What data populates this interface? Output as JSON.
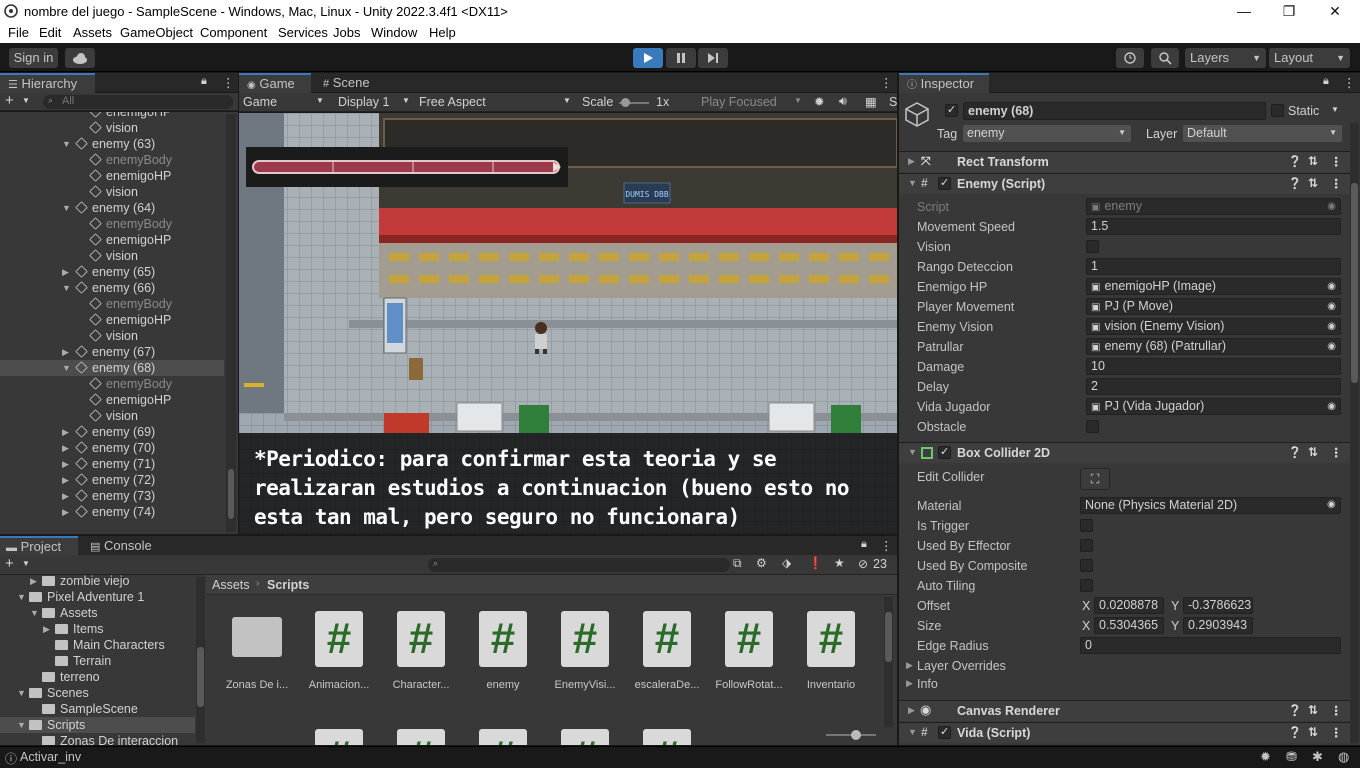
{
  "window": {
    "title": "nombre del juego - SampleScene - Windows, Mac, Linux - Unity 2022.3.4f1 <DX11>"
  },
  "menu": [
    "File",
    "Edit",
    "Assets",
    "GameObject",
    "Component",
    "Services",
    "Jobs",
    "Window",
    "Help"
  ],
  "toolbar": {
    "sign_in": "Sign in",
    "layers": "Layers",
    "layout": "Layout"
  },
  "hierarchy": {
    "tab": "Hierarchy",
    "search_placeholder": "All",
    "rows": [
      {
        "label": "enemigoHP",
        "indent": 2,
        "arrow": ""
      },
      {
        "label": "vision",
        "indent": 2,
        "arrow": ""
      },
      {
        "label": "enemy (63)",
        "indent": 1,
        "arrow": "▼"
      },
      {
        "label": "enemyBody",
        "indent": 2,
        "arrow": "",
        "dim": true
      },
      {
        "label": "enemigoHP",
        "indent": 2,
        "arrow": ""
      },
      {
        "label": "vision",
        "indent": 2,
        "arrow": ""
      },
      {
        "label": "enemy (64)",
        "indent": 1,
        "arrow": "▼"
      },
      {
        "label": "enemyBody",
        "indent": 2,
        "arrow": "",
        "dim": true
      },
      {
        "label": "enemigoHP",
        "indent": 2,
        "arrow": ""
      },
      {
        "label": "vision",
        "indent": 2,
        "arrow": ""
      },
      {
        "label": "enemy (65)",
        "indent": 1,
        "arrow": "▶"
      },
      {
        "label": "enemy (66)",
        "indent": 1,
        "arrow": "▼"
      },
      {
        "label": "enemyBody",
        "indent": 2,
        "arrow": "",
        "dim": true
      },
      {
        "label": "enemigoHP",
        "indent": 2,
        "arrow": ""
      },
      {
        "label": "vision",
        "indent": 2,
        "arrow": ""
      },
      {
        "label": "enemy (67)",
        "indent": 1,
        "arrow": "▶"
      },
      {
        "label": "enemy (68)",
        "indent": 1,
        "arrow": "▼",
        "selected": true
      },
      {
        "label": "enemyBody",
        "indent": 2,
        "arrow": "",
        "dim": true
      },
      {
        "label": "enemigoHP",
        "indent": 2,
        "arrow": ""
      },
      {
        "label": "vision",
        "indent": 2,
        "arrow": ""
      },
      {
        "label": "enemy (69)",
        "indent": 1,
        "arrow": "▶"
      },
      {
        "label": "enemy (70)",
        "indent": 1,
        "arrow": "▶"
      },
      {
        "label": "enemy (71)",
        "indent": 1,
        "arrow": "▶"
      },
      {
        "label": "enemy (72)",
        "indent": 1,
        "arrow": "▶"
      },
      {
        "label": "enemy (73)",
        "indent": 1,
        "arrow": "▶"
      },
      {
        "label": "enemy (74)",
        "indent": 1,
        "arrow": "▶"
      }
    ]
  },
  "game": {
    "tab_game": "Game",
    "tab_scene": "Scene",
    "view": "Game",
    "display": "Display 1",
    "aspect": "Free Aspect",
    "scale_label": "Scale",
    "scale_value": "1x",
    "play_focused": "Play Focused",
    "sign_text": "DUMIS DBB",
    "dialog_line1": "*Periodico: para confirmar esta teoria y se",
    "dialog_line2": "realizaran estudios a continuacion (bueno esto no",
    "dialog_line3": "esta tan mal, pero seguro no funcionara)"
  },
  "inspector": {
    "tab": "Inspector",
    "object_name": "enemy (68)",
    "static": "Static",
    "tag_label": "Tag",
    "tag": "enemy",
    "layer_label": "Layer",
    "layer": "Default",
    "rect_transform": "Rect Transform",
    "enemy_script": "Enemy (Script)",
    "fields": [
      {
        "label": "Script",
        "value": "enemy",
        "type": "obj",
        "dim": true
      },
      {
        "label": "Movement Speed",
        "value": "1.5",
        "type": "text"
      },
      {
        "label": "Vision",
        "value": "",
        "type": "check"
      },
      {
        "label": "Rango Deteccion",
        "value": "1",
        "type": "text"
      },
      {
        "label": "Enemigo HP",
        "value": "enemigoHP (Image)",
        "type": "obj"
      },
      {
        "label": "Player Movement",
        "value": "PJ (P Move)",
        "type": "obj"
      },
      {
        "label": "Enemy Vision",
        "value": "vision (Enemy Vision)",
        "type": "obj"
      },
      {
        "label": "Patrullar",
        "value": "enemy (68) (Patrullar)",
        "type": "obj"
      },
      {
        "label": "Damage",
        "value": "10",
        "type": "text"
      },
      {
        "label": "Delay",
        "value": "2",
        "type": "text"
      },
      {
        "label": "Vida Jugador",
        "value": "PJ (Vida Jugador)",
        "type": "obj"
      },
      {
        "label": "Obstacle",
        "value": "",
        "type": "check"
      }
    ],
    "box_collider": "Box Collider 2D",
    "bc_fields": {
      "edit_collider": "Edit Collider",
      "material": "Material",
      "material_value": "None (Physics Material 2D)",
      "is_trigger": "Is Trigger",
      "used_by_effector": "Used By Effector",
      "used_by_composite": "Used By Composite",
      "auto_tiling": "Auto Tiling",
      "offset": "Offset",
      "offset_x": "0.0208878",
      "offset_y": "-0.3786623",
      "size": "Size",
      "size_x": "0.5304365",
      "size_y": "0.2903943",
      "edge_radius": "Edge Radius",
      "edge_radius_value": "0",
      "x": "X",
      "y": "Y",
      "layer_overrides": "Layer Overrides",
      "info": "Info"
    },
    "canvas_renderer": "Canvas Renderer",
    "vida_script": "Vida (Script)"
  },
  "project": {
    "tab_project": "Project",
    "tab_console": "Console",
    "count": "23",
    "path_root": "Assets",
    "path_leaf": "Scripts",
    "tree": [
      {
        "label": "zombie viejo",
        "indent": 2,
        "arrow": "▶"
      },
      {
        "label": "Pixel Adventure 1",
        "indent": 1,
        "arrow": "▼"
      },
      {
        "label": "Assets",
        "indent": 2,
        "arrow": "▼"
      },
      {
        "label": "Items",
        "indent": 3,
        "arrow": "▶"
      },
      {
        "label": "Main Characters",
        "indent": 3,
        "arrow": ""
      },
      {
        "label": "Terrain",
        "indent": 3,
        "arrow": ""
      },
      {
        "label": "terreno",
        "indent": 2,
        "arrow": ""
      },
      {
        "label": "Scenes",
        "indent": 1,
        "arrow": "▼"
      },
      {
        "label": "SampleScene",
        "indent": 2,
        "arrow": ""
      },
      {
        "label": "Scripts",
        "indent": 1,
        "arrow": "▼",
        "selected": true
      },
      {
        "label": "Zonas De interaccion",
        "indent": 2,
        "arrow": ""
      }
    ],
    "assets": [
      "Zonas De i...",
      "Animacion...",
      "Character...",
      "enemy",
      "EnemyVisi...",
      "escaleraDe...",
      "FollowRotat...",
      "Inventario"
    ]
  },
  "status": {
    "text": "Activar_inv"
  },
  "colors": {
    "accent": "#3a79bb",
    "panel": "#383838",
    "toolbar": "#191919",
    "script_green": "#2a6b2a"
  }
}
